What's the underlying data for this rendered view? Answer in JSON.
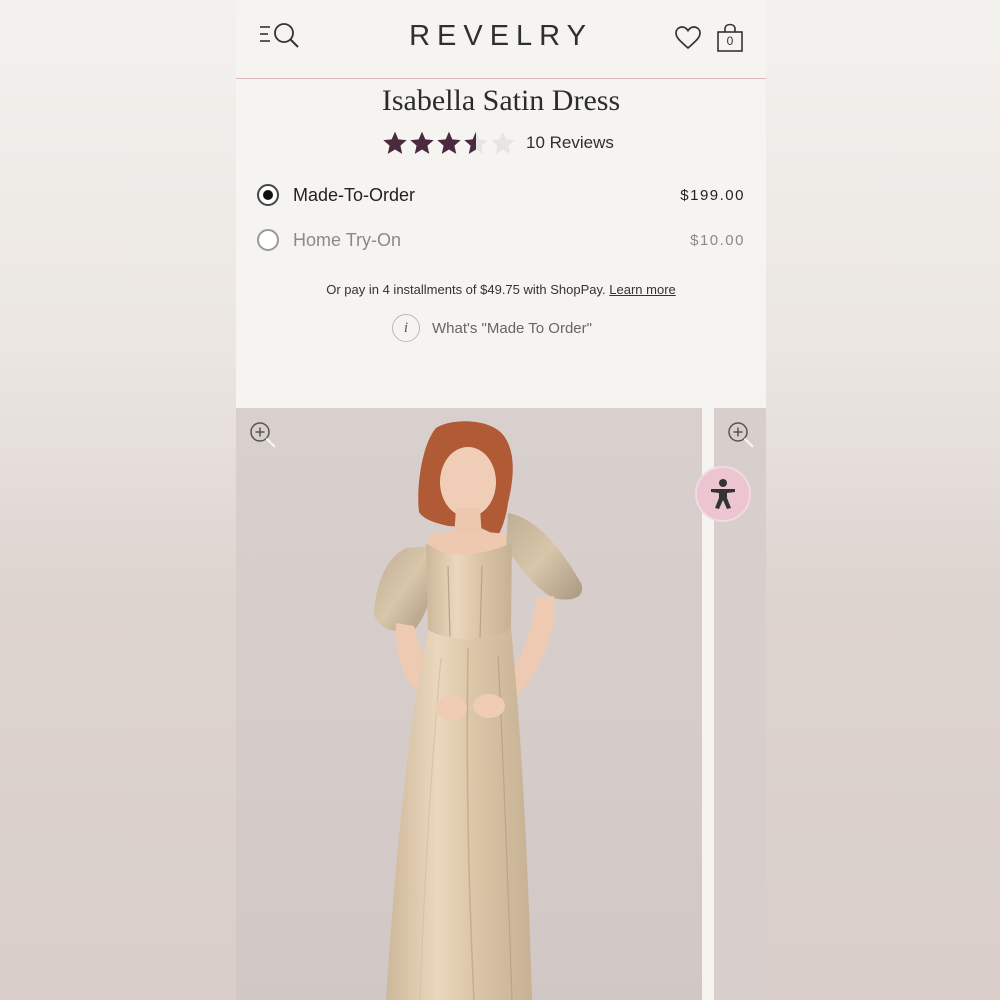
{
  "header": {
    "logo": "REVELRY",
    "bag_count": "0",
    "icons": [
      "menu-search-icon",
      "heart-icon",
      "shopping-bag-icon"
    ]
  },
  "product": {
    "title": "Isabella Satin Dress",
    "rating": 3.5,
    "rating_max": 5,
    "reviews_label": "10 Reviews"
  },
  "options": [
    {
      "label": "Made-To-Order",
      "price": "$199.00",
      "selected": true
    },
    {
      "label": "Home Try-On",
      "price": "$10.00",
      "selected": false
    }
  ],
  "installments": {
    "text": "Or pay in 4 installments of $49.75 with ShopPay.",
    "link": "Learn more"
  },
  "info": {
    "icon": "i",
    "text": "What's \"Made To Order\""
  },
  "colors": {
    "star_filled": "#4a2a3f",
    "star_empty": "#e7e5e3",
    "header_border": "#dcb8ba",
    "accessibility_bg": "#ecc5d0"
  }
}
